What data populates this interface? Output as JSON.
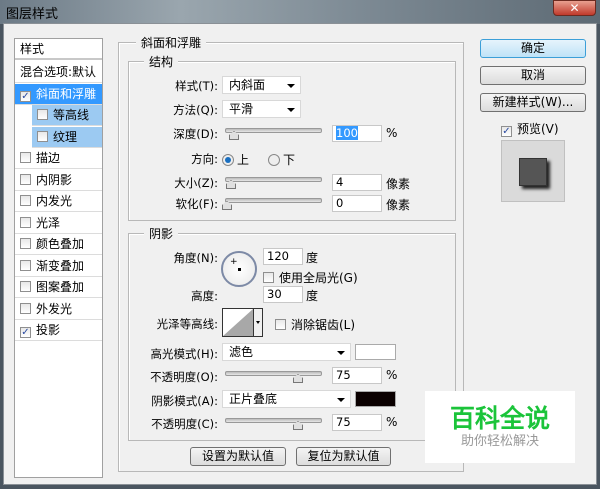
{
  "window": {
    "title": "图层样式",
    "close": "✕"
  },
  "sidebar": {
    "header": "样式",
    "items": [
      {
        "label": "混合选项:默认",
        "checkbox": false,
        "checked": false
      },
      {
        "label": "斜面和浮雕",
        "checkbox": true,
        "checked": true,
        "selected": true
      },
      {
        "label": "等高线",
        "checkbox": true,
        "checked": false,
        "sub": true
      },
      {
        "label": "纹理",
        "checkbox": true,
        "checked": false,
        "sub": true
      },
      {
        "label": "描边",
        "checkbox": true,
        "checked": false
      },
      {
        "label": "内阴影",
        "checkbox": true,
        "checked": false
      },
      {
        "label": "内发光",
        "checkbox": true,
        "checked": false
      },
      {
        "label": "光泽",
        "checkbox": true,
        "checked": false
      },
      {
        "label": "颜色叠加",
        "checkbox": true,
        "checked": false
      },
      {
        "label": "渐变叠加",
        "checkbox": true,
        "checked": false
      },
      {
        "label": "图案叠加",
        "checkbox": true,
        "checked": false
      },
      {
        "label": "外发光",
        "checkbox": true,
        "checked": false
      },
      {
        "label": "投影",
        "checkbox": true,
        "checked": true
      }
    ]
  },
  "main": {
    "title": "斜面和浮雕",
    "structure": {
      "title": "结构",
      "style_label": "样式(T):",
      "style_value": "内斜面",
      "method_label": "方法(Q):",
      "method_value": "平滑",
      "depth_label": "深度(D):",
      "depth_value": "100",
      "depth_unit": "%",
      "depth_fraction": 0.1,
      "direction_label": "方向:",
      "dir_up": "上",
      "dir_down": "下",
      "size_label": "大小(Z):",
      "size_value": "4",
      "size_unit": "像素",
      "size_fraction": 0.02,
      "soften_label": "软化(F):",
      "soften_value": "0",
      "soften_unit": "像素",
      "soften_fraction": 0
    },
    "shading": {
      "title": "阴影",
      "angle_label": "角度(N):",
      "angle_value": "120",
      "angle_unit": "度",
      "global_light": "使用全局光(G)",
      "altitude_label": "高度:",
      "altitude_value": "30",
      "altitude_unit": "度",
      "gloss_label": "光泽等高线:",
      "anti_alias": "消除锯齿(L)",
      "highlight_label": "高光模式(H):",
      "highlight_value": "滤色",
      "highlight_color": "#ffffff",
      "h_opacity_label": "不透明度(O):",
      "h_opacity_value": "75",
      "shadow_label": "阴影模式(A):",
      "shadow_value": "正片叠底",
      "shadow_color": "#0a0000",
      "s_opacity_label": "不透明度(C):",
      "s_opacity_value": "75",
      "percent": "%"
    },
    "make_default": "设置为默认值",
    "reset_default": "复位为默认值"
  },
  "right": {
    "ok": "确定",
    "cancel": "取消",
    "new_style": "新建样式(W)...",
    "preview": "预览(V)"
  },
  "watermark": {
    "brand": "百科全说",
    "slogan": "助你轻松解决"
  }
}
